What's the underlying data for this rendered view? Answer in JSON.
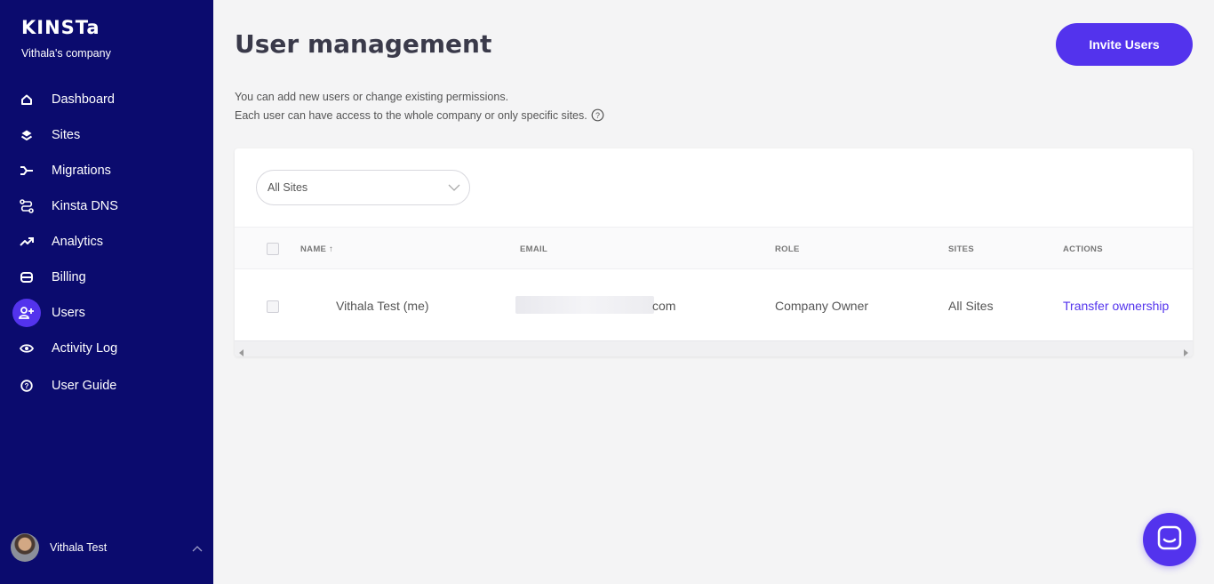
{
  "sidebar": {
    "logo": "KINSTa",
    "company": "Vithala's company",
    "items": [
      {
        "label": "Dashboard",
        "icon": "home-icon"
      },
      {
        "label": "Sites",
        "icon": "layers-icon"
      },
      {
        "label": "Migrations",
        "icon": "migrations-icon"
      },
      {
        "label": "Kinsta DNS",
        "icon": "dns-icon"
      },
      {
        "label": "Analytics",
        "icon": "trend-icon"
      },
      {
        "label": "Billing",
        "icon": "billing-icon"
      },
      {
        "label": "Users",
        "icon": "add-user-icon",
        "active": true
      },
      {
        "label": "Activity Log",
        "icon": "eye-icon"
      },
      {
        "label": "User Guide",
        "icon": "help-circle-icon"
      }
    ],
    "user": {
      "name": "Vithala Test"
    }
  },
  "header": {
    "title": "User management",
    "invite_label": "Invite Users"
  },
  "description": {
    "line1": "You can add new users or change existing permissions.",
    "line2": "Each user can have access to the whole company or only specific sites."
  },
  "filter": {
    "selected": "All Sites"
  },
  "table": {
    "columns": {
      "name": "NAME ↑",
      "email": "EMAIL",
      "role": "ROLE",
      "sites": "SITES",
      "actions": "ACTIONS"
    },
    "rows": [
      {
        "name": "Vithala Test (me)",
        "email_suffix": "com",
        "role": "Company Owner",
        "sites": "All Sites",
        "action": "Transfer ownership"
      }
    ]
  },
  "colors": {
    "sidebar_bg": "#0b0b6e",
    "accent": "#5333ed",
    "page_bg": "#f4f4f5"
  }
}
